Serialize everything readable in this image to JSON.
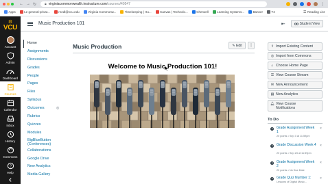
{
  "browser": {
    "url_host": "virginiacommonwealth.instructure.com",
    "url_path": "/courses/49547",
    "bookmarks": [
      {
        "label": "Apps",
        "color": "#4285f4"
      },
      {
        "label": "Le general-privat...",
        "color": "#e8453c"
      },
      {
        "label": "reedl@vcu.edu",
        "color": "#e8453c"
      },
      {
        "label": "Virginia Commonw...",
        "color": "#4285f4"
      },
      {
        "label": "Timekeeping | Hu...",
        "color": "#f8b300"
      },
      {
        "label": "Canvas | Technolo...",
        "color": "#e8453c"
      },
      {
        "label": "Cherwell",
        "color": "#1a73e8"
      },
      {
        "label": "Learning Systems...",
        "color": "#34a853"
      },
      {
        "label": "Banner",
        "color": "#1a73e8"
      },
      {
        "label": "T4",
        "color": "#5f6368"
      }
    ],
    "reading_list": "Reading List"
  },
  "global_nav": {
    "logo_text": "VCU",
    "items": [
      {
        "label": "Account",
        "icon": "avatar"
      },
      {
        "label": "Admin",
        "icon": "shield-icon"
      },
      {
        "label": "Dashboard",
        "icon": "dashboard-icon"
      },
      {
        "label": "Courses",
        "icon": "book-icon"
      },
      {
        "label": "Calendar",
        "icon": "calendar-icon"
      },
      {
        "label": "Inbox",
        "icon": "inbox-icon"
      },
      {
        "label": "History",
        "icon": "clock-icon"
      },
      {
        "label": "Commons",
        "icon": "commons-icon"
      },
      {
        "label": "Help",
        "icon": "help-icon"
      }
    ],
    "active": "Courses"
  },
  "header": {
    "course_title": "Music Production 101",
    "student_view_label": "Student View"
  },
  "course_nav": {
    "items": [
      "Home",
      "Assignments",
      "Discussions",
      "Grades",
      "People",
      "Pages",
      "Files",
      "Syllabus",
      "Outcomes",
      "Rubrics",
      "Quizzes",
      "Modules",
      "BigBlueButton (Conferences)",
      "Collaborations",
      "Google Drive",
      "New Analytics",
      "Media Gallery"
    ],
    "active": "Home"
  },
  "main": {
    "page_title": "Music Production",
    "edit_label": "Edit",
    "more_label": "⋮",
    "welcome_heading": "Welcome to Music Production 101!"
  },
  "sidebar": {
    "buttons": [
      {
        "label": "Import Existing Content",
        "icon": "import-icon"
      },
      {
        "label": "Import from Commons",
        "icon": "commons-icon"
      },
      {
        "label": "Choose Home Page",
        "icon": "home-icon"
      },
      {
        "label": "View Course Stream",
        "icon": "stream-icon"
      },
      {
        "label": "New Announcement",
        "icon": "announcement-icon"
      },
      {
        "label": "New Analytics",
        "icon": "analytics-icon"
      },
      {
        "label": "View Course Notifications",
        "icon": "bell-icon"
      }
    ],
    "todo_title": "To Do",
    "todo": [
      {
        "name": "Grade Assignment Week 1",
        "meta": "20 points • Sep 3 at 11:59pm"
      },
      {
        "name": "Grade Discussion Week 4",
        "meta": "20 points • Sep 23 at 11:59pm"
      },
      {
        "name": "Grade Assignment Week 2",
        "meta": "20 points • No Due Date"
      },
      {
        "name": "Grade Quiz Number 1:",
        "meta": "Lessons of Digital Music..."
      }
    ]
  },
  "colors": {
    "vcu_gold": "#f8b300",
    "link_blue": "#0770a3",
    "nav_black": "#1a1a1a"
  }
}
